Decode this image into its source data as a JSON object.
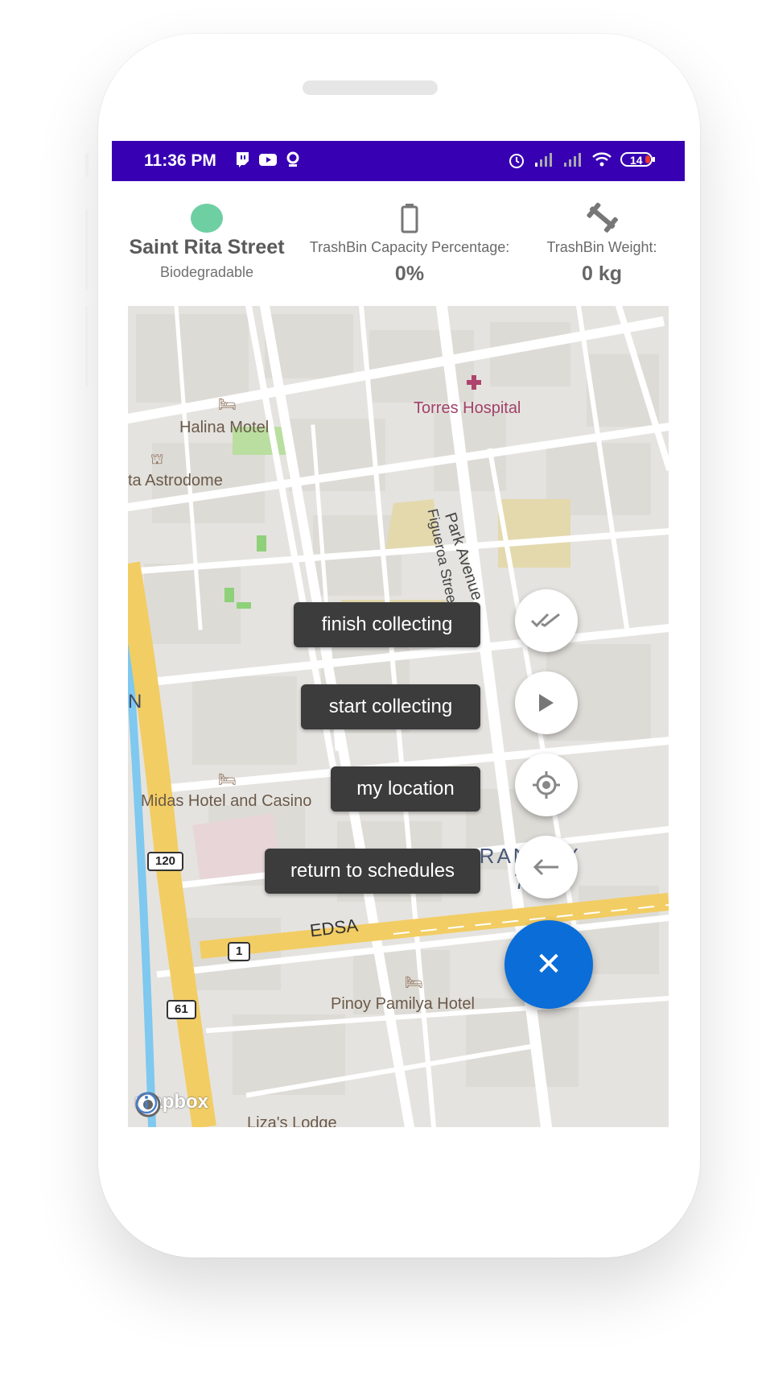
{
  "status_bar": {
    "time": "11:36 PM",
    "battery": "14",
    "left_icons": [
      "twitch-icon",
      "youtube-icon",
      "location-icon"
    ],
    "right_icons": [
      "alarm-icon",
      "signal-icon",
      "signal-icon",
      "wifi-icon",
      "battery-icon"
    ]
  },
  "bin_info": {
    "street": "Saint Rita Street",
    "type": "Biodegradable",
    "status_color": "#6ecfa3",
    "capacity_label": "TrashBin Capacity Percentage:",
    "capacity_value": "0%",
    "weight_label": "TrashBin Weight:",
    "weight_value": "0 kg"
  },
  "map": {
    "labels": {
      "torres": "Torres Hospital",
      "halina": "Halina Motel",
      "astrodome": "ta Astrodome",
      "park_avenue": "Park Avenue",
      "figueroa": "Figueroa Street",
      "n_letter": "N",
      "midas": "Midas Hotel and Casino",
      "barangay": "BARANGAY",
      "barangay_num": "75",
      "edsa": "EDSA",
      "pinoy": "Pinoy Pamilya Hotel",
      "lizas": "Liza's Lodge"
    },
    "shields": {
      "s120": "120",
      "s1": "1",
      "s61": "61"
    },
    "attribution": "mapbox"
  },
  "actions": {
    "finish": "finish collecting",
    "start": "start collecting",
    "location": "my location",
    "return": "return to schedules",
    "close": "✕"
  }
}
